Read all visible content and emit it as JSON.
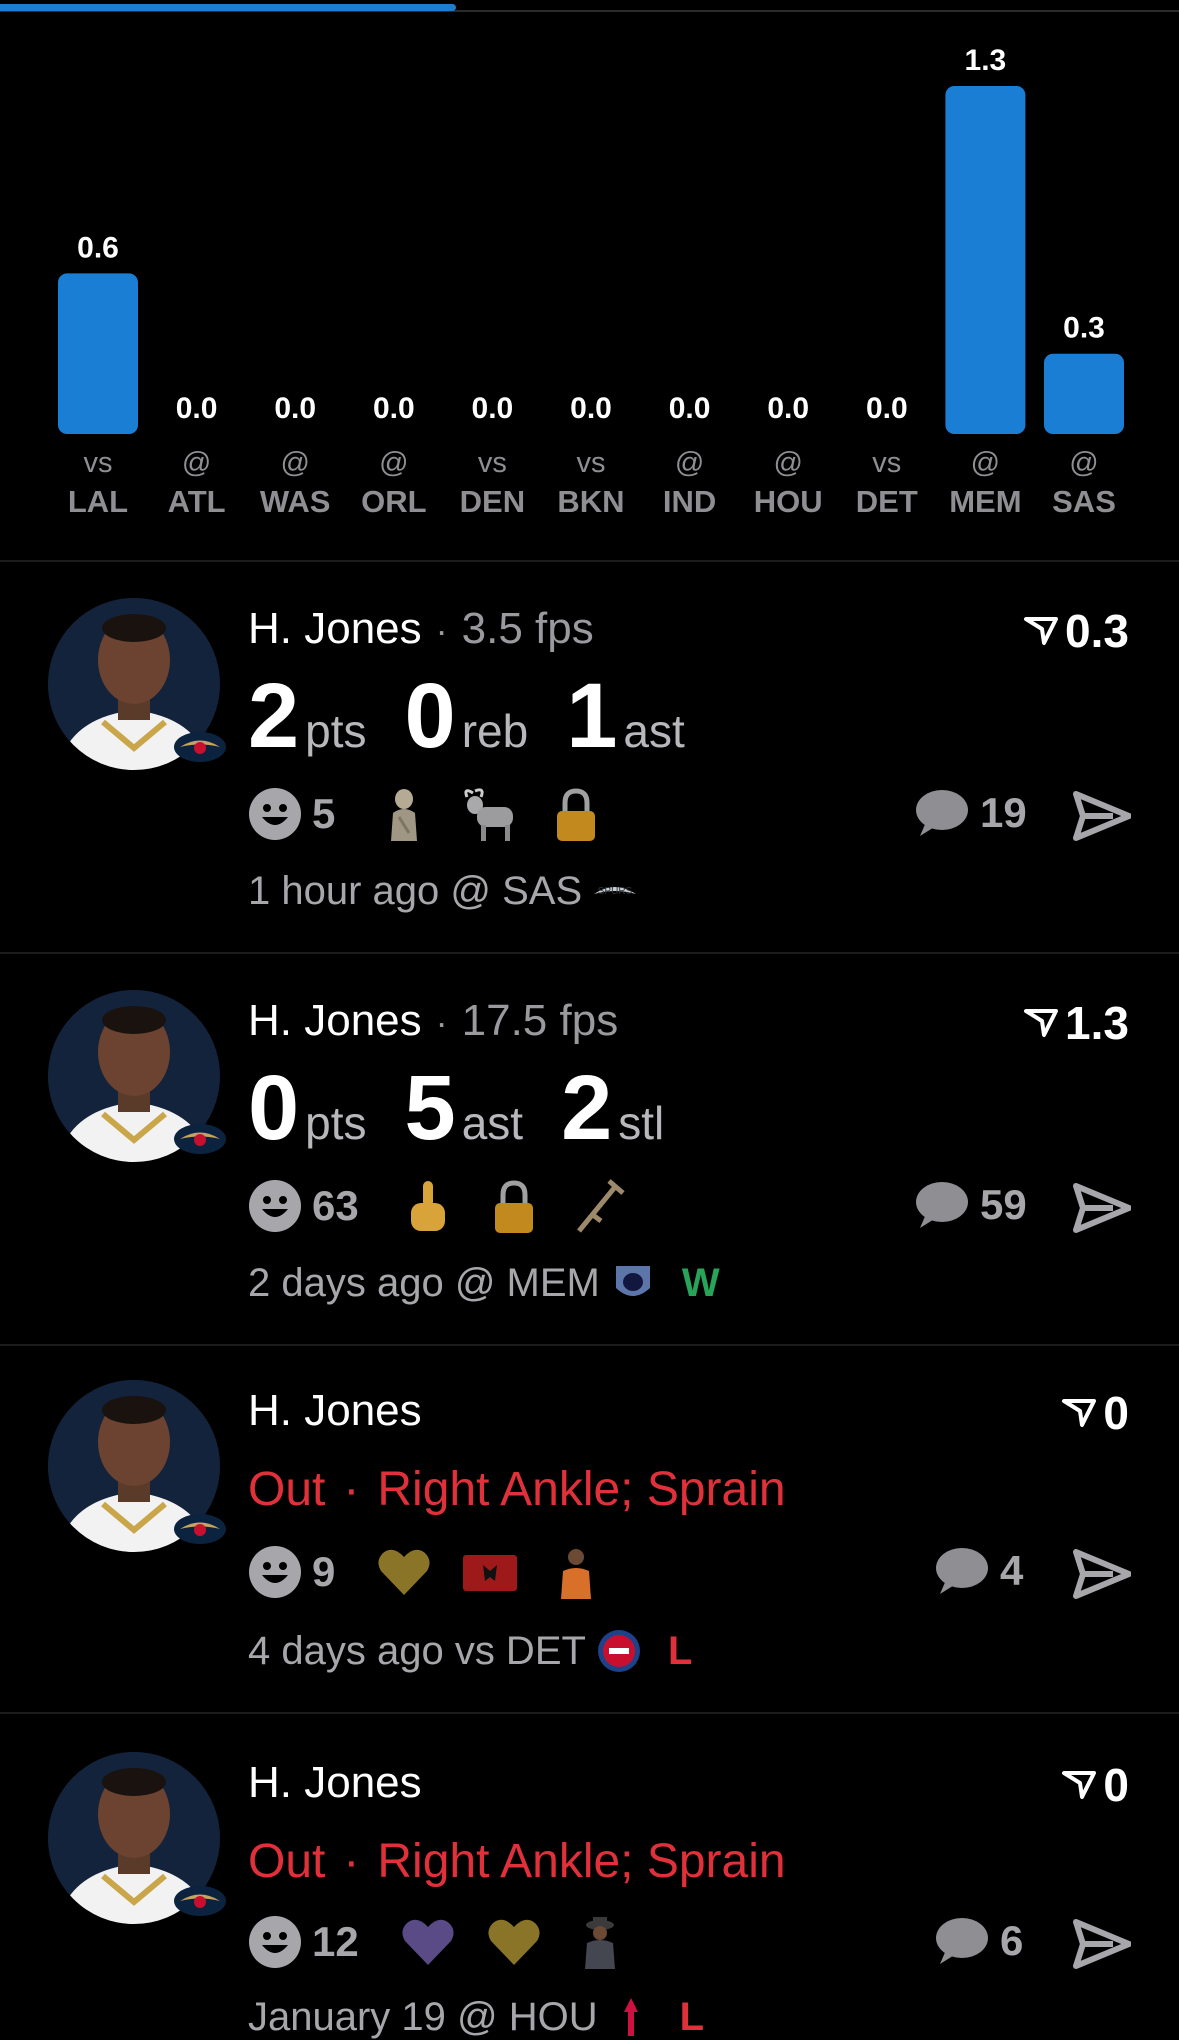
{
  "progress": {
    "fraction": 0.387,
    "fill_color": "#1a7fd4"
  },
  "chart_data": {
    "type": "bar",
    "bar_color": "#1a7fd4",
    "value_labels": [
      "0.6",
      "0.0",
      "0.0",
      "0.0",
      "0.0",
      "0.0",
      "0.0",
      "0.0",
      "0.0",
      "1.3",
      "0.3"
    ],
    "categories": [
      {
        "loc": "vs",
        "team": "LAL"
      },
      {
        "loc": "@",
        "team": "ATL"
      },
      {
        "loc": "@",
        "team": "WAS"
      },
      {
        "loc": "@",
        "team": "ORL"
      },
      {
        "loc": "vs",
        "team": "DEN"
      },
      {
        "loc": "vs",
        "team": "BKN"
      },
      {
        "loc": "@",
        "team": "IND"
      },
      {
        "loc": "@",
        "team": "HOU"
      },
      {
        "loc": "vs",
        "team": "DET"
      },
      {
        "loc": "@",
        "team": "MEM"
      },
      {
        "loc": "@",
        "team": "SAS"
      }
    ],
    "values": [
      0.6,
      0,
      0,
      0,
      0,
      0,
      0,
      0,
      0,
      1.3,
      0.3
    ],
    "ylim": [
      0,
      1.3
    ]
  },
  "posts": [
    {
      "name": "H. Jones",
      "fps": "3.5 fps",
      "score": "0.3",
      "stats": [
        {
          "num": "2",
          "label": "pts"
        },
        {
          "num": "0",
          "label": "reb"
        },
        {
          "num": "1",
          "label": "ast"
        }
      ],
      "reaction_count": "5",
      "emojis": [
        "statue-emoji",
        "goat-emoji",
        "lock-emoji"
      ],
      "comments": "19",
      "meta": "1 hour ago @ SAS",
      "opponent_logo": "spurs-logo-icon",
      "result": ""
    },
    {
      "name": "H. Jones",
      "fps": "17.5 fps",
      "score": "1.3",
      "stats": [
        {
          "num": "0",
          "label": "pts"
        },
        {
          "num": "5",
          "label": "ast"
        },
        {
          "num": "2",
          "label": "stl"
        }
      ],
      "reaction_count": "63",
      "emojis": [
        "middle-finger-emoji",
        "lock-emoji",
        "crutch-emoji"
      ],
      "comments": "59",
      "meta": "2 days ago @ MEM",
      "opponent_logo": "grizzlies-logo-icon",
      "result": "W",
      "result_color": "#27a35a"
    },
    {
      "name": "H. Jones",
      "score": "0",
      "status": "Out",
      "injury": "Right Ankle; Sprain",
      "reaction_count": "9",
      "emojis": [
        "gold-heart-emoji",
        "albania-flag-emoji",
        "person-emoji"
      ],
      "comments": "4",
      "meta": "4 days ago vs DET",
      "opponent_logo": "pistons-logo-icon",
      "result": "L",
      "result_color": "#e0313b"
    },
    {
      "name": "H. Jones",
      "score": "0",
      "status": "Out",
      "injury": "Right Ankle; Sprain",
      "reaction_count": "12",
      "emojis": [
        "purple-heart-emoji",
        "gold-heart-emoji",
        "cowboy-person-emoji"
      ],
      "comments": "6",
      "meta": "January 19 @ HOU",
      "opponent_logo": "rockets-logo-icon",
      "result": "L",
      "result_color": "#e0313b"
    }
  ]
}
